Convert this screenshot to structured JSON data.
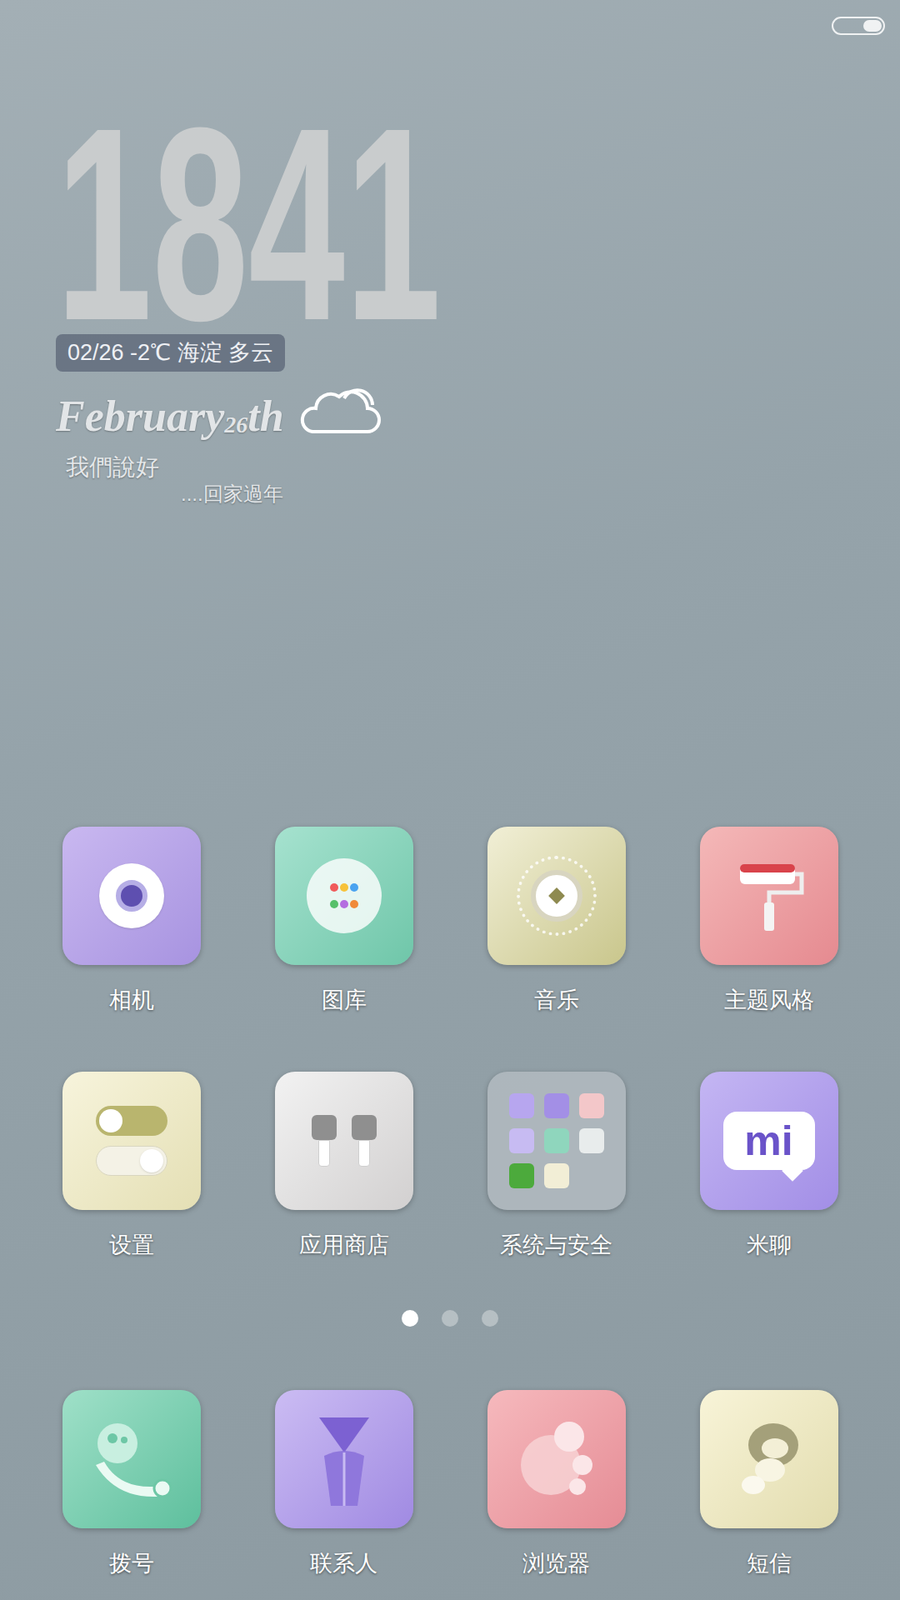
{
  "status_bar": {
    "battery_level": 0.4
  },
  "clock_widget": {
    "time": "1841",
    "info": "02/26 -2℃ 海淀 多云",
    "month": "February",
    "day": "26",
    "day_suffix": "th",
    "note_line1": "我們說好",
    "note_line2": "....回家過年"
  },
  "apps": [
    {
      "label": "相机",
      "kind": "camera"
    },
    {
      "label": "图库",
      "kind": "gallery"
    },
    {
      "label": "音乐",
      "kind": "music"
    },
    {
      "label": "主题风格",
      "kind": "theme"
    },
    {
      "label": "设置",
      "kind": "settings"
    },
    {
      "label": "应用商店",
      "kind": "store"
    },
    {
      "label": "系统与安全",
      "kind": "folder"
    },
    {
      "label": "米聊",
      "kind": "chat",
      "logo": "mi"
    }
  ],
  "pages": [
    {
      "selected": true
    },
    {
      "selected": false
    },
    {
      "selected": false
    }
  ],
  "dock": [
    {
      "label": "拨号",
      "kind": "dialer"
    },
    {
      "label": "联系人",
      "kind": "contacts"
    },
    {
      "label": "浏览器",
      "kind": "browser"
    },
    {
      "label": "短信",
      "kind": "sms"
    }
  ]
}
